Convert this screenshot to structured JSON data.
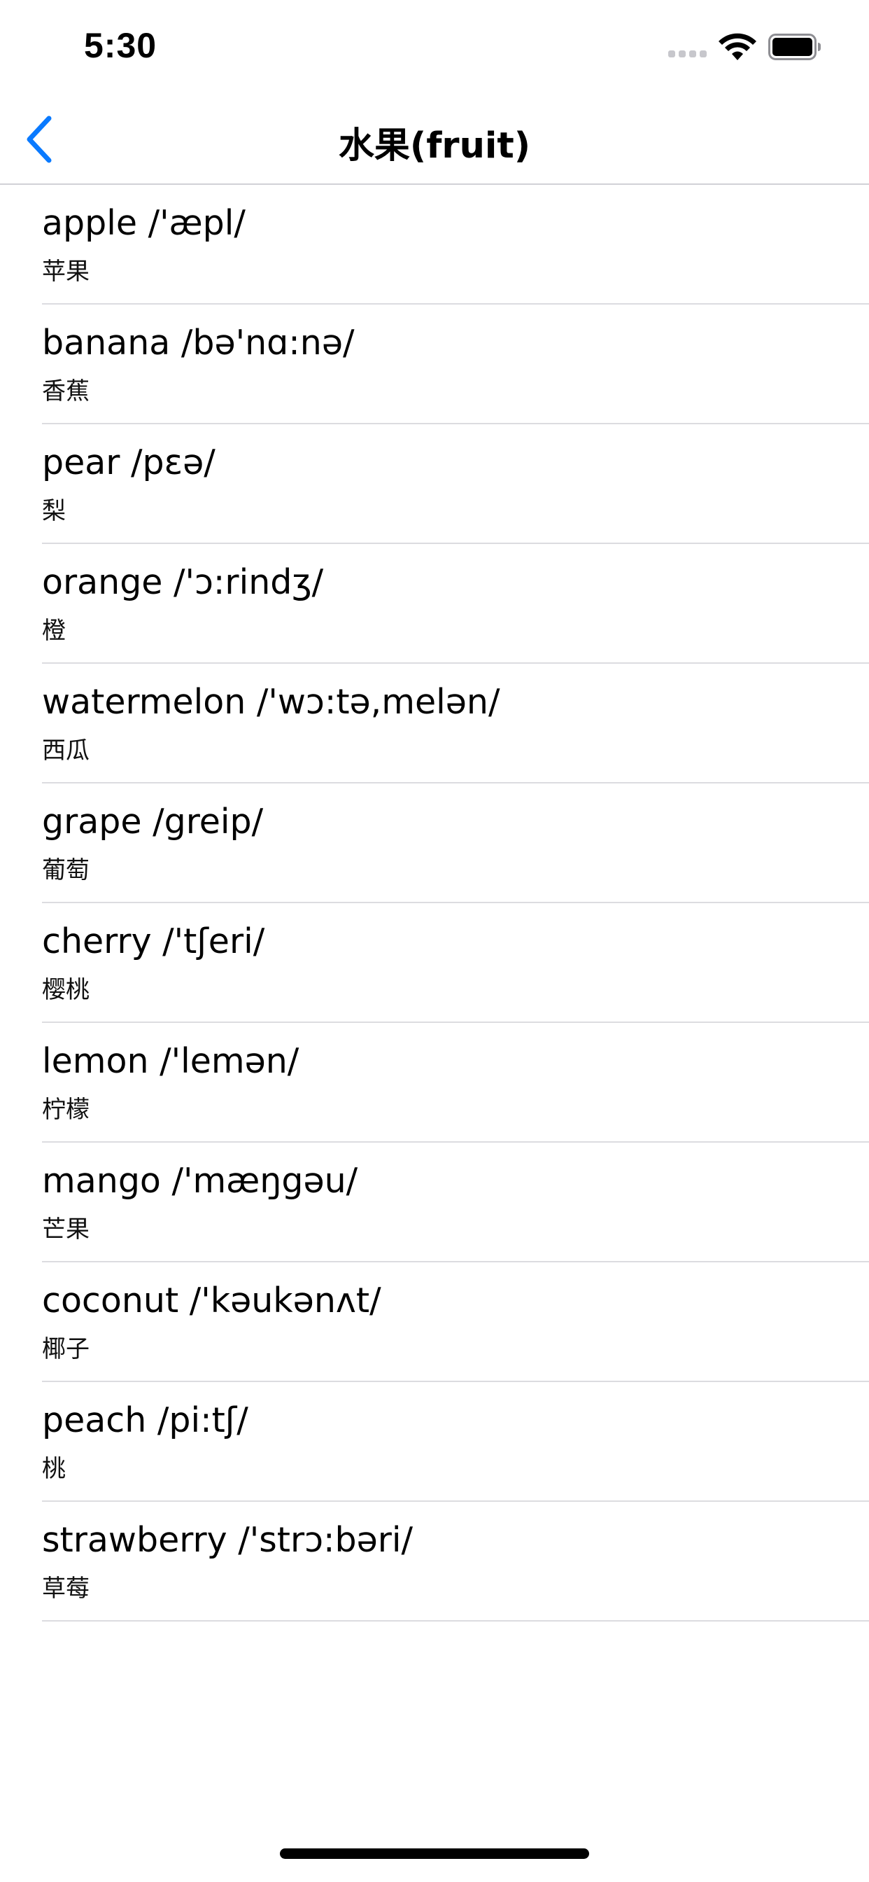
{
  "status_bar": {
    "time": "5:30",
    "wifi_icon": "wifi-icon",
    "battery_icon": "battery-icon"
  },
  "nav": {
    "title": "水果(fruit)",
    "back_icon": "chevron-left-icon",
    "accent_color": "#0a7aff"
  },
  "words": [
    {
      "word": "apple /'æpl/",
      "meaning": "苹果"
    },
    {
      "word": "banana /bə'nɑ:nə/",
      "meaning": "香蕉"
    },
    {
      "word": "pear /pεə/",
      "meaning": "梨"
    },
    {
      "word": "orange /'ɔ:rindʒ/",
      "meaning": "橙"
    },
    {
      "word": "watermelon /'wɔ:tə,melən/",
      "meaning": "西瓜"
    },
    {
      "word": "grape /greip/",
      "meaning": "葡萄"
    },
    {
      "word": "cherry /'tʃeri/",
      "meaning": "樱桃"
    },
    {
      "word": "lemon /'lemən/",
      "meaning": "柠檬"
    },
    {
      "word": "mango /'mæŋgəu/",
      "meaning": "芒果"
    },
    {
      "word": "coconut /'kəukənʌt/",
      "meaning": "椰子"
    },
    {
      "word": "peach /pi:tʃ/",
      "meaning": "桃"
    },
    {
      "word": "strawberry /'strɔ:bəri/",
      "meaning": "草莓"
    }
  ]
}
